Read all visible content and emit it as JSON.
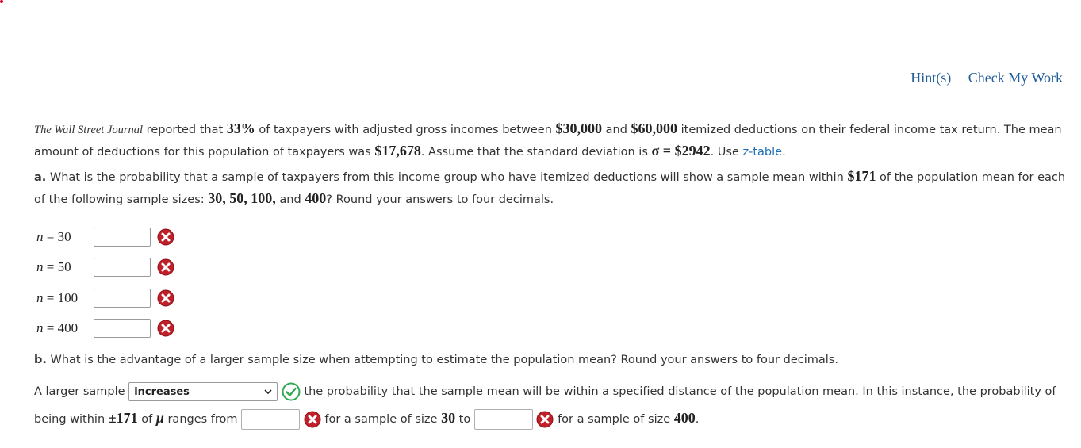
{
  "top_links": {
    "hints": "Hint(s)",
    "check": "Check My Work"
  },
  "intro": {
    "source": "The Wall Street Journal",
    "t1": " reported that ",
    "pct": "33%",
    "t2": " of taxpayers with adjusted gross incomes between ",
    "low": "$30,000",
    "t3": " and ",
    "high": "$60,000",
    "t4": " itemized deductions on their federal income tax return. The mean amount of deductions for this population of taxpayers was ",
    "mean": "$17,678",
    "t5": ". Assume that the standard deviation is ",
    "sigma": "σ = $2942",
    "t6": ". Use ",
    "ztable": "z-table",
    "t7": "."
  },
  "part_a": {
    "label": "a.",
    "t1": " What is the probability that a sample of taxpayers from this income group who have itemized deductions will show a sample mean within ",
    "within": "$171",
    "t2": " of the population mean for each of the following sample sizes: ",
    "sizes": "30, 50, 100,",
    "t3": " and ",
    "last": "400",
    "t4": "? Round your answers to four decimals.",
    "rows": [
      {
        "var": "n",
        "eq": " = 30",
        "value": ""
      },
      {
        "var": "n",
        "eq": " = 50",
        "value": ""
      },
      {
        "var": "n",
        "eq": " = 100",
        "value": ""
      },
      {
        "var": "n",
        "eq": " = 400",
        "value": ""
      }
    ]
  },
  "part_b": {
    "label": "b.",
    "question": " What is the advantage of a larger sample size when attempting to estimate the population mean? Round your answers to four decimals.",
    "s1": "A larger sample",
    "select_value": "increases",
    "s2": "the probability that the sample mean will be within a specified distance of the population mean. In this instance, the probability of being within ",
    "pm": "±171",
    "s3": " of ",
    "mu": "μ",
    "s4": " ranges from",
    "s5": "for a sample of size ",
    "n1": "30",
    "s6": " to",
    "s7": "for a sample of size ",
    "n2": "400",
    "s8": "."
  },
  "colors": {
    "link": "#1f5c99",
    "wrong": "#c0202a",
    "correct": "#2fa84f"
  },
  "icons": {
    "wrong": "x-circle-icon",
    "correct": "check-circle-icon",
    "dropdown": "chevron-down-icon"
  }
}
